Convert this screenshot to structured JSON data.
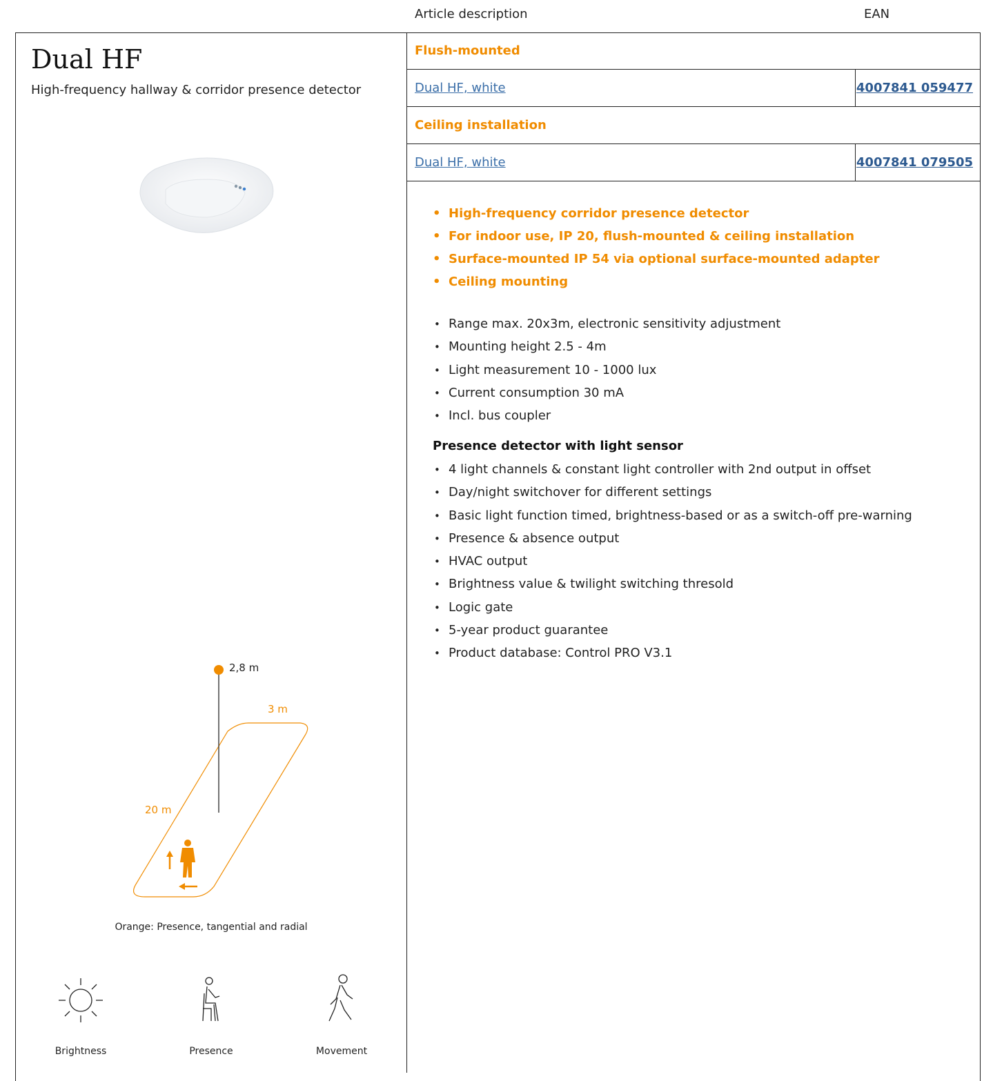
{
  "header": {
    "article_description": "Article description",
    "ean": "EAN"
  },
  "product": {
    "title": "Dual HF",
    "subtitle": "High-frequency hallway & corridor presence detector"
  },
  "table": {
    "group1": {
      "heading": "Flush-mounted",
      "name": "Dual HF, white",
      "ean": "4007841 059477"
    },
    "group2": {
      "heading": "Ceiling installation",
      "name": "Dual HF, white",
      "ean": "4007841 079505"
    }
  },
  "features": [
    "High-frequency corridor presence detector",
    "For indoor use, IP 20, flush-mounted & ceiling installation",
    "Surface-mounted IP 54 via optional surface-mounted adapter",
    "Ceiling mounting"
  ],
  "specs": [
    "Range max. 20x3m, electronic sensitivity adjustment",
    "Mounting height 2.5 - 4m",
    "Light measurement 10 - 1000 lux",
    "Current consumption 30 mA",
    "Incl. bus coupler"
  ],
  "section_heading": "Presence detector with light sensor",
  "specs2": [
    "4 light channels & constant light controller with 2nd output in offset",
    "Day/night switchover for different settings",
    "Basic light function timed, brightness-based or as a switch-off pre-warning",
    "Presence & absence output",
    "HVAC output",
    "Brightness value & twilight switching thresold",
    "Logic gate",
    "5-year product guarantee",
    "Product database: Control PRO V3.1"
  ],
  "diagram": {
    "height_label": "2,8 m",
    "width_label": "3 m",
    "length_label": "20 m",
    "caption": "Orange: Presence, tangential and radial",
    "accent": "#f08c00"
  },
  "icons": [
    {
      "icon": "sun-icon",
      "label": "Brightness"
    },
    {
      "icon": "seated-person-icon",
      "label": "Presence"
    },
    {
      "icon": "walking-person-icon",
      "label": "Movement"
    }
  ]
}
